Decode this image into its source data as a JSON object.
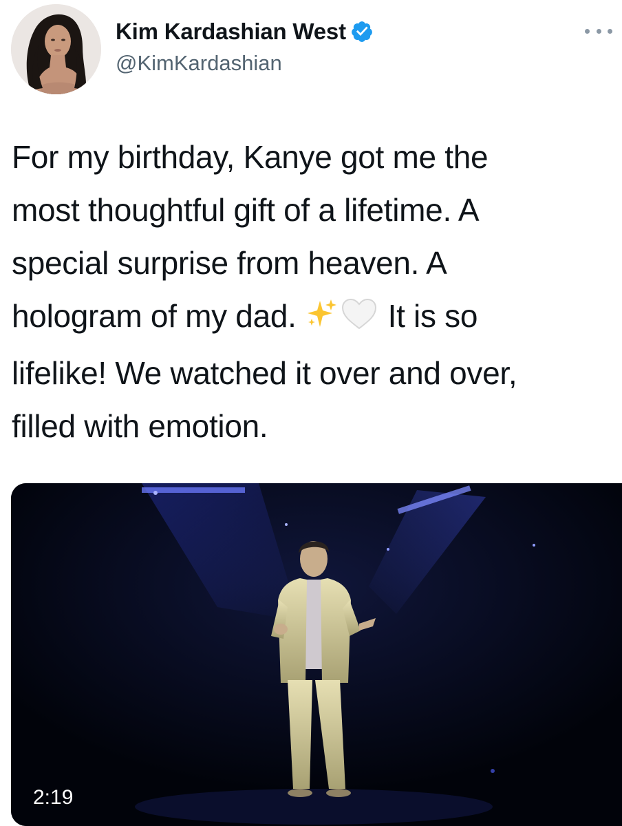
{
  "author": {
    "display_name": "Kim Kardashian West",
    "handle": "@KimKardashian",
    "verified": true,
    "verified_icon": "verified-badge-icon",
    "avatar_icon": "profile-photo"
  },
  "menu": {
    "icon": "more-options-icon"
  },
  "tweet": {
    "lines": [
      "For my birthday, Kanye got me the",
      "most thoughtful gift of a lifetime. A",
      "special surprise from heaven. A",
      "hologram of my dad.",
      "It is so",
      "lifelike! We watched it over and over,",
      "filled with emotion."
    ],
    "emojis": [
      "sparkles-emoji",
      "white-heart-emoji"
    ]
  },
  "media": {
    "type": "video",
    "duration": "2:19",
    "description_icon": "hologram-video-thumbnail"
  },
  "colors": {
    "text": "#0f1419",
    "secondary": "#536471",
    "verified_blue": "#1d9bf0",
    "video_background": "#01030a"
  }
}
